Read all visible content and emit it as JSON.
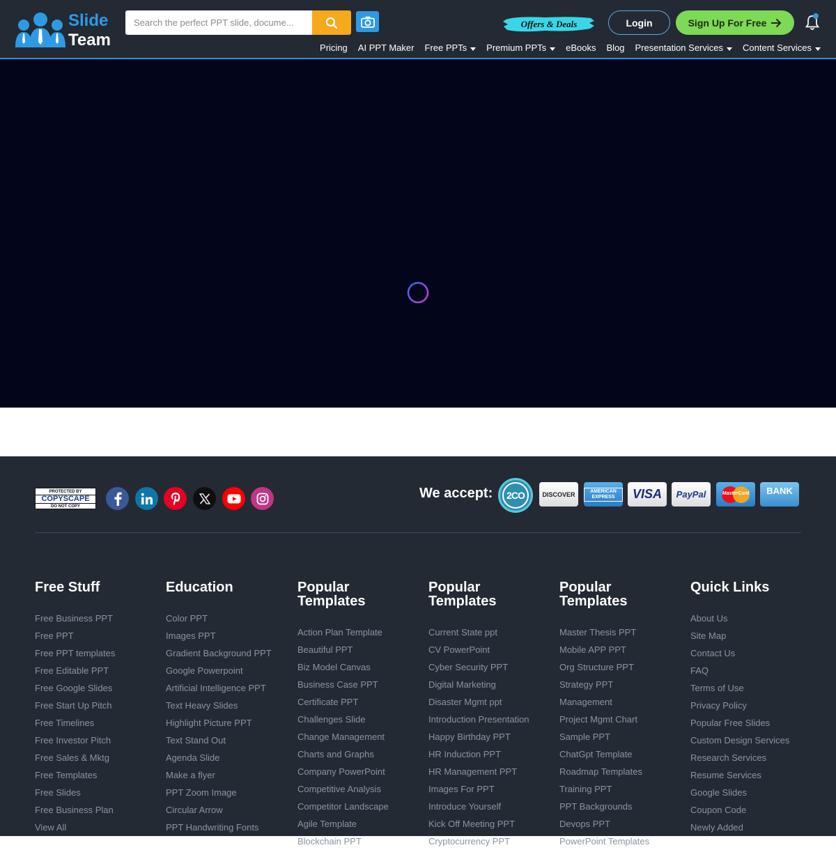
{
  "header": {
    "logo_line1": "Slide",
    "logo_line2": "Team",
    "search_placeholder": "Search the perfect PPT slide, docume...",
    "offers_label": "Offers & Deals",
    "login_label": "Login",
    "signup_label": "Sign Up For Free",
    "nav": [
      {
        "label": "Pricing",
        "dropdown": false
      },
      {
        "label": "AI PPT Maker",
        "dropdown": false
      },
      {
        "label": "Free PPTs",
        "dropdown": true
      },
      {
        "label": "Premium PPTs",
        "dropdown": true
      },
      {
        "label": "eBooks",
        "dropdown": false
      },
      {
        "label": "Blog",
        "dropdown": false
      },
      {
        "label": "Presentation Services",
        "dropdown": true
      },
      {
        "label": "Content Services",
        "dropdown": true
      }
    ]
  },
  "footer": {
    "copyscape": {
      "top": "PROTECTED BY",
      "mid": "COPYSCAPE",
      "bottom": "DO NOT COPY"
    },
    "social_icons": [
      "facebook-icon",
      "linkedin-icon",
      "pinterest-icon",
      "x-icon",
      "youtube-icon",
      "instagram-icon"
    ],
    "we_accept_label": "We accept:",
    "payment_methods": [
      "2CO",
      "DISCOVER",
      "AMERICAN EXPRESS",
      "VISA",
      "PayPal",
      "MasterCard",
      "BANK"
    ],
    "columns": [
      {
        "title": "Free Stuff",
        "links": [
          "Free Business PPT",
          "Free PPT",
          "Free PPT templates",
          "Free Editable PPT",
          "Free Google Slides",
          "Free Start Up Pitch",
          "Free Timelines",
          "Free Investor Pitch",
          "Free Sales & Mktg",
          "Free Templates",
          "Free Slides",
          "Free Business Plan",
          "View All"
        ]
      },
      {
        "title": "Education",
        "links": [
          "Color PPT",
          "Images PPT",
          "Gradient Background PPT",
          "Google Powerpoint",
          "Artificial Intelligence PPT",
          "Text Heavy Slides",
          "Highlight Picture PPT",
          "Text Stand Out",
          "Agenda Slide",
          "Make a flyer",
          "PPT Zoom Image",
          "Circular Arrow",
          "PPT Handwriting Fonts"
        ]
      },
      {
        "title": "Popular Templates",
        "links": [
          "Action Plan Template",
          "Beautiful PPT",
          "Biz Model Canvas",
          "Business Case PPT",
          "Certificate PPT",
          "Challenges Slide",
          "Change Management",
          "Charts and Graphs",
          "Company PowerPoint",
          "Competitive Analysis",
          "Competitor Landscape",
          "Agile Template",
          "Blockchain PPT"
        ]
      },
      {
        "title": "Popular Templates",
        "links": [
          "Current State ppt",
          "CV PowerPoint",
          "Cyber Security PPT",
          "Digital Marketing",
          "Disaster Mgmt ppt",
          "Introduction Presentation",
          "Happy Birthday PPT",
          "HR Induction PPT",
          "HR Management PPT",
          "Images For PPT",
          "Introduce Yourself",
          "Kick Off Meeting PPT",
          "Cryptocurrency PPT"
        ]
      },
      {
        "title": "Popular Templates",
        "links": [
          "Master Thesis PPT",
          "Mobile APP PPT",
          "Org Structure PPT",
          "Strategy PPT",
          "Management",
          "Project Mgmt Chart",
          "Sample PPT",
          "ChatGpt Template",
          "Roadmap Templates",
          "Training PPT",
          "PPT Backgrounds",
          "Devops PPT",
          "PowerPoint Templates"
        ]
      },
      {
        "title": "Quick Links",
        "links": [
          "About Us",
          "Site Map",
          "Contact Us",
          "FAQ",
          "Terms of Use",
          "Privacy Policy",
          "Popular Free Slides",
          "Custom Design Services",
          "Research Services",
          "Resume Services",
          "Google Slides",
          "Coupon Code",
          "Newly Added"
        ]
      }
    ]
  }
}
